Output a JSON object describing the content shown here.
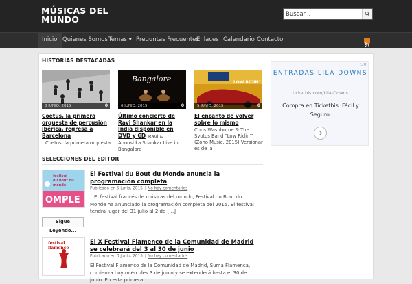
{
  "site": {
    "title": "MÚSICAS DEL MUNDO"
  },
  "search": {
    "placeholder": "Buscar..."
  },
  "nav": {
    "items": [
      {
        "label": "Inicio"
      },
      {
        "label": "Quienes Somos"
      },
      {
        "label": "Temas ▾"
      },
      {
        "label": "Preguntas Frecuentes"
      },
      {
        "label": "Enlaces"
      },
      {
        "label": "Calendario"
      },
      {
        "label": "Contacto"
      }
    ]
  },
  "featured": {
    "heading": "HISTORIAS DESTACADAS",
    "items": [
      {
        "date": "8 JUNIO, 2015",
        "count": "0",
        "title": "Coetus, la primera orquesta de percusión ibérica, regresa a Barcelona",
        "excerpt": "Coetus, la primera orquesta"
      },
      {
        "date": "6 JUNIO, 2015",
        "count": "0",
        "title": "Último concierto de Ravi Shankar en la India disponible en DVD y CD",
        "excerpt": "El CD y DVD Ravi & Anoushka Shankar Live in Bangalore",
        "image_text": "Bangalore"
      },
      {
        "date": "5 JUNIO, 2015",
        "count": "0",
        "title": "El encanto de volver sobre lo mismo",
        "excerpt": "Chris Washburne & The Syotos Band \"Low Ridin'\" (Zoho Music, 2015) Versionar es de la",
        "image_text": "LOW RIDIN'"
      }
    ]
  },
  "ad": {
    "title": "ENTRADAS LILA DOWNS",
    "url": "ticketbis.com/Lila-Downs",
    "text": "Compra en Ticketbis. Fácil y Seguro."
  },
  "editor": {
    "heading": "SELECCIONES DEL EDITOR",
    "more_label": "Sigue Leyendo...",
    "posts": [
      {
        "title": "El Festival du Bout du Monde anuncia la programación completa",
        "published": "Publicado en 5 junio, 2015",
        "comments": "No hay comentarios",
        "excerpt": "El festival francés de músicas del mundo, Festival du Bout du Monde ha anunciado la programación completa del 2015. El festival tendrá lugar del 31 julio al 2 de […]",
        "image_text": "festival du bout du monde",
        "image_text2": "OMPLE"
      },
      {
        "title": "El X Festival Flamenco de la Comunidad de Madrid se celebrará del 3 al 30 de junio",
        "published": "Publicado en 3 junio, 2015",
        "comments": "No hay comentarios",
        "excerpt": "El Festival Flamenco de la Comunidad de Madrid, Suma Flamenca, comienza hoy miércoles 3 de junio y se extenderá hasta el 30 de junio. En esta primera",
        "image_text": "festival flamenco"
      }
    ]
  }
}
